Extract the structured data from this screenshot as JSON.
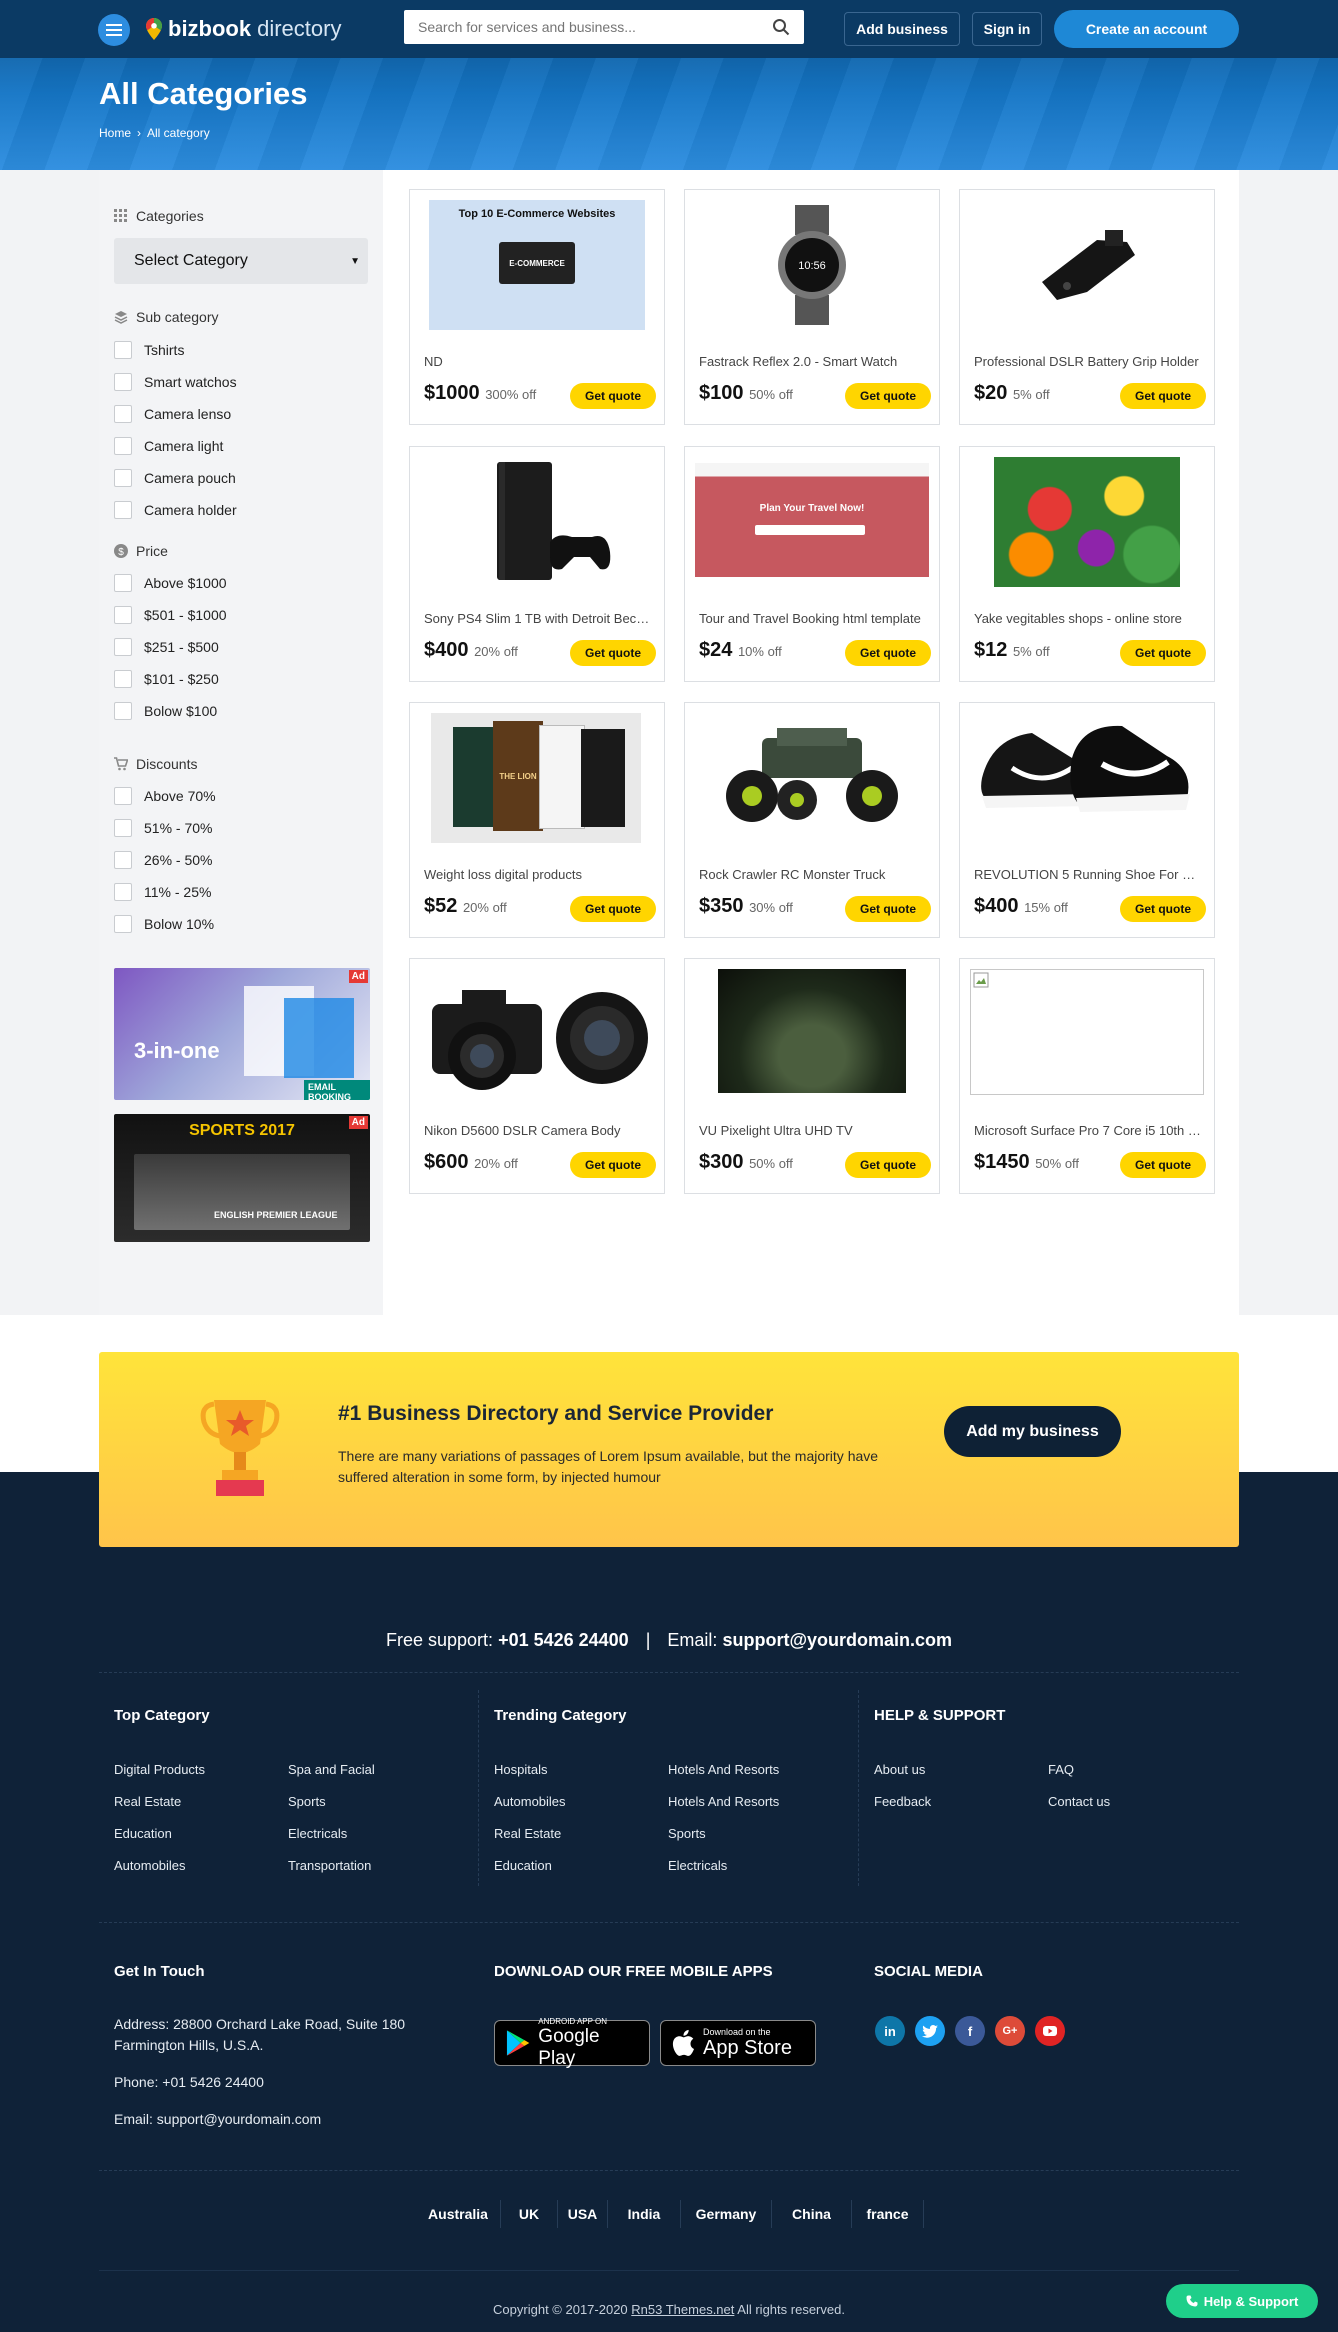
{
  "header": {
    "logo_bold": "bizbook",
    "logo_light": "directory",
    "search_placeholder": "Search for services and business...",
    "add_business": "Add business",
    "sign_in": "Sign in",
    "create_account": "Create an account",
    "page_title": "All Categories",
    "breadcrumb": [
      "Home",
      "All category"
    ]
  },
  "sidebar": {
    "categories_label": "Categories",
    "select_value": "Select Category",
    "subcategory_label": "Sub category",
    "subcategories": [
      "Tshirts",
      "Smart watchos",
      "Camera lenso",
      "Camera light",
      "Camera pouch",
      "Camera holder"
    ],
    "price_label": "Price",
    "prices": [
      "Above $1000",
      "$501 - $1000",
      "$251 - $500",
      "$101 - $250",
      "Bolow $100"
    ],
    "discounts_label": "Discounts",
    "discounts": [
      "Above 70%",
      "51% - 70%",
      "26% - 50%",
      "11% - 25%",
      "Bolow 10%"
    ],
    "ad_tag": "Ad",
    "ad1_text": "3-in-one",
    "ad1_sub": "EMAIL BOOKING",
    "ad2_title": "SPORTS 2017",
    "ad2_sub": "ENGLISH PREMIER LEAGUE"
  },
  "products": [
    {
      "name": "ND",
      "price": "$1000",
      "off": "300% off",
      "img_label": "Top 10 E-Commerce Websites",
      "img_sub": "E-COMMERCE"
    },
    {
      "name": "Fastrack Reflex 2.0 - Smart Watch",
      "price": "$100",
      "off": "50% off",
      "img_label": "10:56"
    },
    {
      "name": "Professional DSLR Battery Grip Holder",
      "price": "$20",
      "off": "5% off"
    },
    {
      "name": "Sony PS4 Slim 1 TB with Detroit Become Human",
      "price": "$400",
      "off": "20% off"
    },
    {
      "name": "Tour and Travel  Booking html template",
      "price": "$24",
      "off": "10% off",
      "img_label": "Plan Your Travel Now!"
    },
    {
      "name": "Yake vegitables shops - online store",
      "price": "$12",
      "off": "5% off"
    },
    {
      "name": "Weight loss digital products",
      "price": "$52",
      "off": "20% off",
      "img_label": "THE LION"
    },
    {
      "name": "Rock Crawler RC Monster Truck",
      "price": "$350",
      "off": "30% off"
    },
    {
      "name": "REVOLUTION 5 Running Shoe For Men",
      "price": "$400",
      "off": "15% off"
    },
    {
      "name": "Nikon D5600 DSLR Camera Body",
      "price": "$600",
      "off": "20% off"
    },
    {
      "name": "VU Pixelight Ultra UHD TV",
      "price": "$300",
      "off": "50% off"
    },
    {
      "name": "Microsoft Surface Pro 7 Core i5 10th Gen",
      "price": "$1450",
      "off": "50% off"
    }
  ],
  "quote_label": "Get quote",
  "banner": {
    "title": "#1 Business Directory and Service Provider",
    "text": "There are many variations of passages of Lorem Ipsum available, but the majority have suffered alteration in some form, by injected humour",
    "button": "Add my business"
  },
  "footer": {
    "support_label": "Free support:",
    "support_phone": "+01 5426 24400",
    "email_label": "Email:",
    "support_email": "support@yourdomain.com",
    "top_category_title": "Top Category",
    "top_category": [
      "Digital Products",
      "Spa and Facial",
      "Real Estate",
      "Sports",
      "Education",
      "Electricals",
      "Automobiles",
      "Transportation"
    ],
    "trending_title": "Trending Category",
    "trending": [
      "Hospitals",
      "Hotels And Resorts",
      "Automobiles",
      "Hotels And Resorts",
      "Real Estate",
      "Sports",
      "Education",
      "Electricals"
    ],
    "help_title": "HELP & SUPPORT",
    "help": [
      "About us",
      "FAQ",
      "Feedback",
      "Contact us"
    ],
    "touch_title": "Get In Touch",
    "address": "Address: 28800 Orchard Lake Road, Suite 180 Farmington Hills, U.S.A.",
    "phone": "Phone: +01 5426 24400",
    "email": "Email: support@yourdomain.com",
    "apps_title": "DOWNLOAD OUR FREE MOBILE APPS",
    "gp_small": "ANDROID APP ON",
    "gp_big": "Google Play",
    "as_small": "Download on the",
    "as_big": "App Store",
    "social_title": "SOCIAL MEDIA",
    "countries": [
      "Australia",
      "UK",
      "USA",
      "India",
      "Germany",
      "China",
      "france"
    ],
    "copyright_pre": "Copyright © 2017-2020",
    "copyright_link": "Rn53 Themes.net",
    "copyright_post": "All rights reserved.",
    "help_button": "Help & Support"
  }
}
